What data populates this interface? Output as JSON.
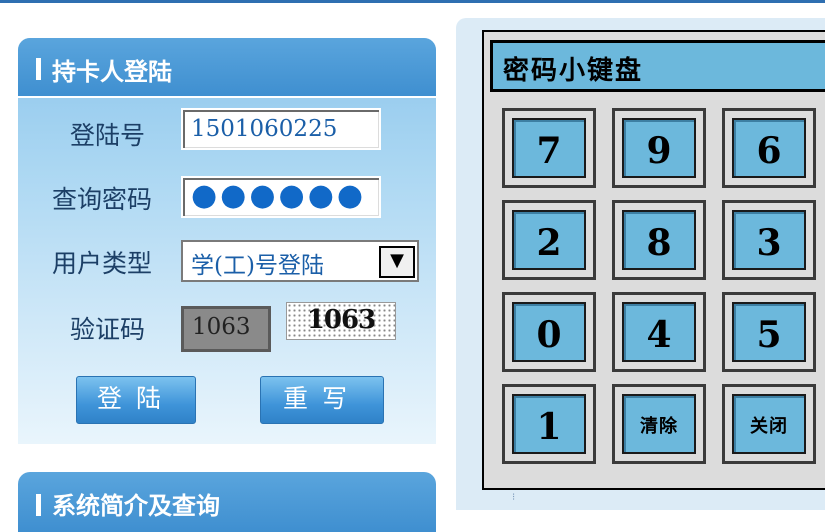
{
  "login": {
    "title": "持卡人登陆",
    "account_label": "登陆号",
    "account_value": "1501060225",
    "password_label": "查询密码",
    "password_value": "●●●●●●",
    "usertype_label": "用户类型",
    "usertype_value": "学(工)号登陆",
    "captcha_label": "验证码",
    "captcha_value": "1063",
    "captcha_image_text": "1063",
    "login_button": "登陆",
    "reset_button": "重写"
  },
  "section2": {
    "title": "系统简介及查询"
  },
  "keypad": {
    "title": "密码小键盘",
    "keys": [
      "7",
      "9",
      "6",
      "2",
      "8",
      "3",
      "0",
      "4",
      "5",
      "1",
      "清除",
      "关闭"
    ]
  },
  "colors": {
    "header_blue": "#3f8fd0",
    "keypad_blue": "#6cb8dc",
    "text_dark_blue": "#1c3f66"
  }
}
